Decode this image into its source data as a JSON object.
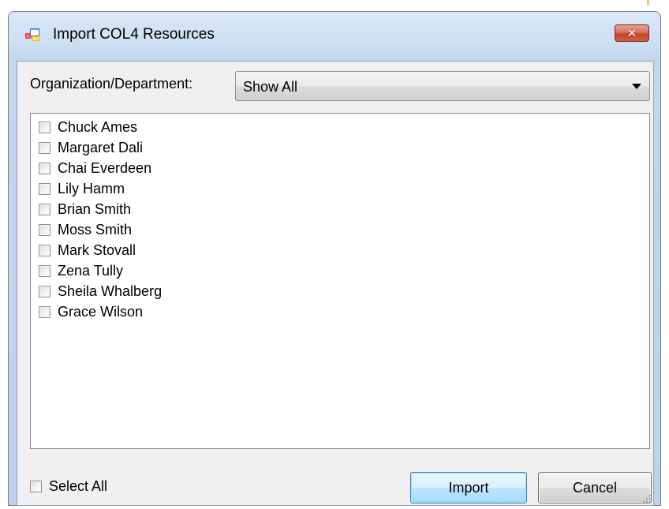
{
  "window": {
    "title": "Import COL4 Resources",
    "icon": "app-window-icon",
    "close_icon": "close-icon",
    "close_glyph": "✕"
  },
  "org_filter": {
    "label": "Organization/Department:",
    "selected": "Show All"
  },
  "resources": {
    "items": [
      {
        "label": "Chuck Ames",
        "checked": false
      },
      {
        "label": "Margaret Dali",
        "checked": false
      },
      {
        "label": "Chai Everdeen",
        "checked": false
      },
      {
        "label": "Lily Hamm",
        "checked": false
      },
      {
        "label": "Brian Smith",
        "checked": false
      },
      {
        "label": "Moss Smith",
        "checked": false
      },
      {
        "label": "Mark Stovall",
        "checked": false
      },
      {
        "label": "Zena Tully",
        "checked": false
      },
      {
        "label": "Sheila Whalberg",
        "checked": false
      },
      {
        "label": "Grace Wilson",
        "checked": false
      }
    ]
  },
  "footer": {
    "select_all_label": "Select All",
    "import_label": "Import",
    "cancel_label": "Cancel"
  },
  "colors": {
    "window_frame": "#bdd1e9",
    "client_background": "#f0f0f0",
    "close_button": "#c2442c",
    "default_button_border": "#3c7fb1"
  }
}
